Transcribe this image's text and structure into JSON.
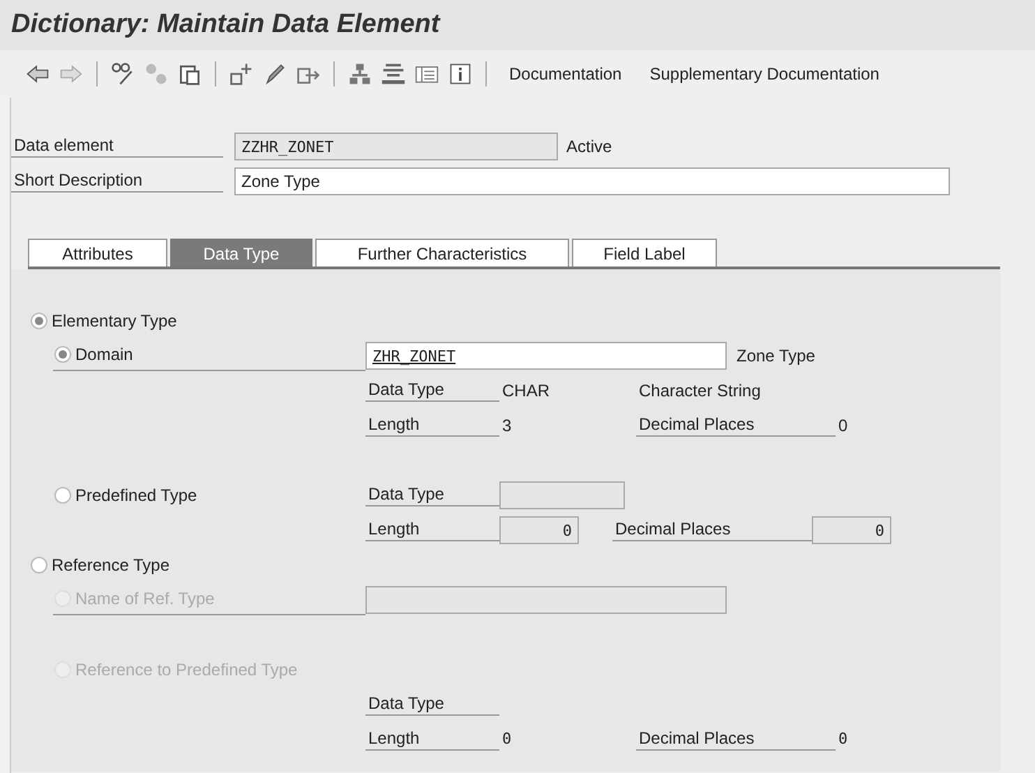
{
  "window": {
    "title": "Dictionary: Maintain Data Element"
  },
  "toolbar": {
    "buttons": [
      "Documentation",
      "Supplementary Documentation"
    ]
  },
  "header": {
    "data_element": {
      "label": "Data element",
      "value": "ZZHR_ZONET",
      "status": "Active"
    },
    "short_description": {
      "label": "Short Description",
      "value": "Zone Type"
    }
  },
  "tabs": [
    {
      "label": "Attributes",
      "selected": false
    },
    {
      "label": "Data Type",
      "selected": true
    },
    {
      "label": "Further Characteristics",
      "selected": false
    },
    {
      "label": "Field Label",
      "selected": false
    }
  ],
  "elementary_type": {
    "label": "Elementary Type",
    "selected": true,
    "disabled": false
  },
  "domain": {
    "label": "Domain",
    "selected": true,
    "disabled": false,
    "value": "ZHR_ZONET",
    "description": "Zone Type"
  },
  "domain_attributes": {
    "data_type_label": "Data Type",
    "data_type": "CHAR",
    "data_type_text": "Character String",
    "length_label": "Length",
    "length": "3",
    "decimals_label": "Decimal Places",
    "decimals": "0"
  },
  "predefined_type": {
    "label": "Predefined Type",
    "selected": false,
    "disabled": false,
    "data_type_label": "Data Type",
    "length_label": "Length",
    "length": "0",
    "decimals_label": "Decimal Places",
    "decimals": "0"
  },
  "reference_type": {
    "label": "Reference Type",
    "selected": false,
    "disabled": false
  },
  "name_of_ref_type": {
    "label": "Name of Ref. Type",
    "selected": false,
    "disabled": true
  },
  "reference_to_predefined": {
    "label": "Reference to Predefined Type",
    "selected": false,
    "disabled": true,
    "data_type_label": "Data Type",
    "length_label": "Length",
    "length": "0",
    "decimals_label": "Decimal Places",
    "decimals": "0"
  }
}
